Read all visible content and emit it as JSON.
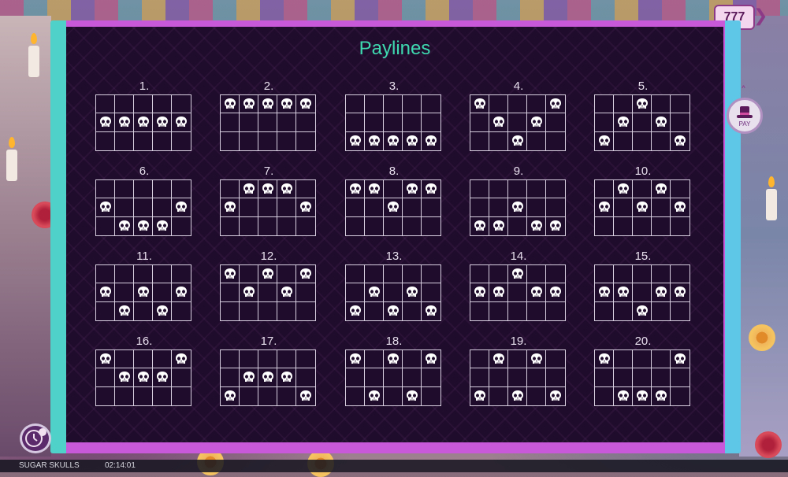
{
  "menu_button_label": "777",
  "pay_button_label": "PAY",
  "title": "Paylines",
  "status": {
    "game_name": "SUGAR SKULLS",
    "time": "02:14:01"
  },
  "paylines": [
    {
      "label": "1.",
      "rows": [
        1,
        1,
        1,
        1,
        1
      ]
    },
    {
      "label": "2.",
      "rows": [
        0,
        0,
        0,
        0,
        0
      ]
    },
    {
      "label": "3.",
      "rows": [
        2,
        2,
        2,
        2,
        2
      ]
    },
    {
      "label": "4.",
      "rows": [
        0,
        1,
        2,
        1,
        0
      ]
    },
    {
      "label": "5.",
      "rows": [
        2,
        1,
        0,
        1,
        2
      ]
    },
    {
      "label": "6.",
      "rows": [
        1,
        2,
        2,
        2,
        1
      ]
    },
    {
      "label": "7.",
      "rows": [
        1,
        0,
        0,
        0,
        1
      ]
    },
    {
      "label": "8.",
      "rows": [
        0,
        0,
        1,
        0,
        0
      ]
    },
    {
      "label": "9.",
      "rows": [
        2,
        2,
        1,
        2,
        2
      ]
    },
    {
      "label": "10.",
      "rows": [
        1,
        0,
        1,
        0,
        1
      ]
    },
    {
      "label": "11.",
      "rows": [
        1,
        2,
        1,
        2,
        1
      ]
    },
    {
      "label": "12.",
      "rows": [
        0,
        1,
        0,
        1,
        0
      ]
    },
    {
      "label": "13.",
      "rows": [
        2,
        1,
        2,
        1,
        2
      ]
    },
    {
      "label": "14.",
      "rows": [
        1,
        1,
        0,
        1,
        1
      ]
    },
    {
      "label": "15.",
      "rows": [
        1,
        1,
        2,
        1,
        1
      ]
    },
    {
      "label": "16.",
      "rows": [
        0,
        1,
        1,
        1,
        0
      ]
    },
    {
      "label": "17.",
      "rows": [
        2,
        1,
        1,
        1,
        2
      ]
    },
    {
      "label": "18.",
      "rows": [
        0,
        2,
        0,
        2,
        0
      ]
    },
    {
      "label": "19.",
      "rows": [
        2,
        0,
        2,
        0,
        2
      ]
    },
    {
      "label": "20.",
      "rows": [
        0,
        2,
        2,
        2,
        0
      ]
    }
  ]
}
